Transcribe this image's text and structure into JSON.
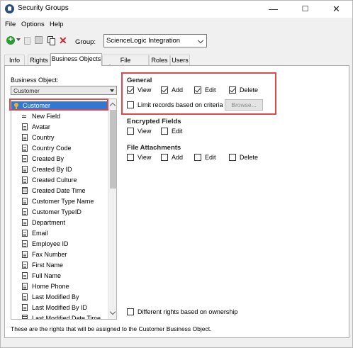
{
  "window": {
    "title": "Security Groups",
    "controls": {
      "minimize": "—",
      "maximize": "☐",
      "close": "✕"
    }
  },
  "menu": [
    "File",
    "Options",
    "Help"
  ],
  "toolbar": {
    "group_label": "Group:",
    "group_value": "ScienceLogic Integration",
    "icons": [
      "add-icon",
      "dropdown-arrow-icon",
      "trash-icon",
      "save-icon",
      "copy-icon",
      "delete-icon"
    ]
  },
  "tabs": [
    {
      "label": "Info",
      "active": false
    },
    {
      "label": "Rights",
      "active": false
    },
    {
      "label": "Business Objects",
      "active": true
    },
    {
      "label": "File Attachments",
      "active": false
    },
    {
      "label": "Roles",
      "active": false
    },
    {
      "label": "Users",
      "active": false
    }
  ],
  "business_object": {
    "label": "Business Object:",
    "value": "Customer",
    "tree_root": "Customer",
    "tree_items": [
      {
        "label": "New Field",
        "icon": "new-field-icon"
      },
      {
        "label": "Avatar",
        "icon": "field-icon"
      },
      {
        "label": "Country",
        "icon": "field-icon"
      },
      {
        "label": "Country Code",
        "icon": "field-icon"
      },
      {
        "label": "Created By",
        "icon": "field-icon"
      },
      {
        "label": "Created By ID",
        "icon": "field-icon"
      },
      {
        "label": "Created Culture",
        "icon": "field-icon"
      },
      {
        "label": "Created Date Time",
        "icon": "datetime-field-icon"
      },
      {
        "label": "Customer Type Name",
        "icon": "field-icon"
      },
      {
        "label": "Customer TypeID",
        "icon": "field-icon"
      },
      {
        "label": "Department",
        "icon": "field-icon"
      },
      {
        "label": "Email",
        "icon": "field-icon"
      },
      {
        "label": "Employee ID",
        "icon": "field-icon"
      },
      {
        "label": "Fax Number",
        "icon": "field-icon"
      },
      {
        "label": "First Name",
        "icon": "field-icon"
      },
      {
        "label": "Full Name",
        "icon": "field-icon"
      },
      {
        "label": "Home Phone",
        "icon": "field-icon"
      },
      {
        "label": "Last Modified By",
        "icon": "field-icon"
      },
      {
        "label": "Last Modified By ID",
        "icon": "field-icon"
      },
      {
        "label": "Last Modified Date Time",
        "icon": "datetime-field-icon"
      }
    ]
  },
  "general": {
    "title": "General",
    "view": "View",
    "add": "Add",
    "edit": "Edit",
    "delete": "Delete",
    "limit": "Limit records based on criteria",
    "browse": "Browse..."
  },
  "encrypted": {
    "title": "Encrypted Fields",
    "view": "View",
    "edit": "Edit"
  },
  "attachments": {
    "title": "File Attachments",
    "view": "View",
    "add": "Add",
    "edit": "Edit",
    "delete": "Delete"
  },
  "ownership": "Different rights based on ownership",
  "status_text": "These are the rights that will be assigned to the Customer Business Object.",
  "colors": {
    "selection": "#3078d0",
    "highlight_box": "#e0474c",
    "add_green": "#2e9a34",
    "delete_red": "#d3262b"
  }
}
